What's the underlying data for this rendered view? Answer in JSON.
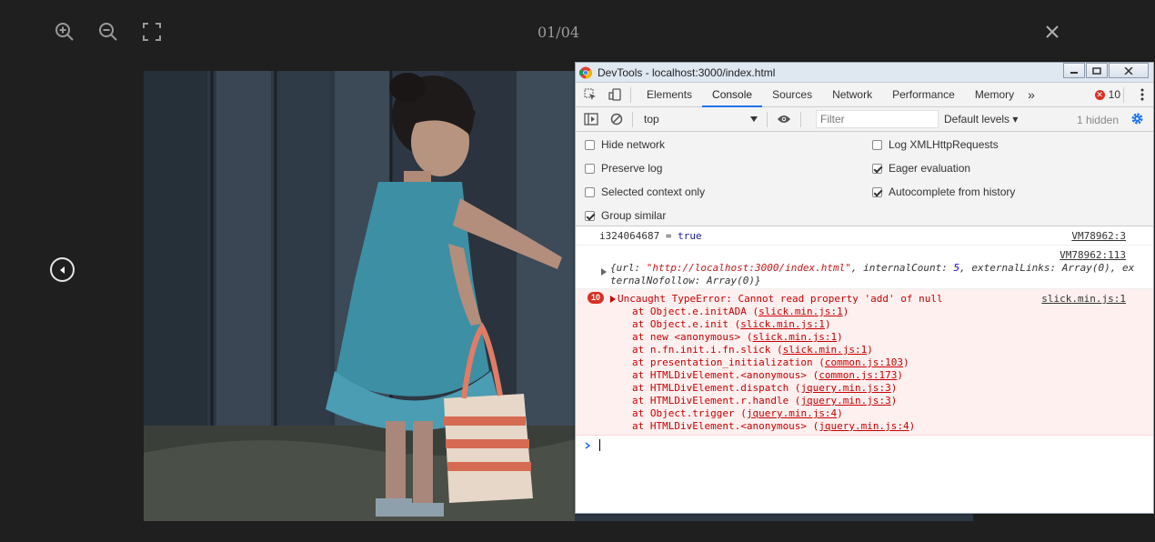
{
  "lightbox": {
    "counter": "01/04",
    "tools": [
      "zoom-in-icon",
      "zoom-out-icon",
      "fullscreen-icon"
    ]
  },
  "devtools": {
    "title": "DevTools - localhost:3000/index.html",
    "tabs": [
      "Elements",
      "Console",
      "Sources",
      "Network",
      "Performance",
      "Memory"
    ],
    "active_tab": "Console",
    "more_tabs": "»",
    "error_count": "10",
    "context": "top",
    "filter_placeholder": "Filter",
    "levels": "Default levels ▾",
    "hidden": "1 hidden",
    "settings": {
      "hide_network": "Hide network",
      "preserve_log": "Preserve log",
      "selected_context": "Selected context only",
      "group_similar": "Group similar",
      "log_xhr": "Log XMLHttpRequests",
      "eager_eval": "Eager evaluation",
      "autocomplete": "Autocomplete from history"
    },
    "messages": {
      "m1_text": "i324064687 = ",
      "m1_val": "true",
      "m1_src": "VM78962:3",
      "m2_src": "VM78962:113",
      "m2_a": "{url: ",
      "m2_url": "\"http://localhost:3000/index.html\"",
      "m2_b": ", internalCount: ",
      "m2_count": "5",
      "m2_c": ", externalLinks: Array(0), ex",
      "m2_d": "ternalNofollow: Array(0)}",
      "err_badge": "10",
      "err_text": "Uncaught TypeError: Cannot read property 'add' of null",
      "err_src": "slick.min.js:1",
      "stack": [
        {
          "pre": "at Object.e.initADA (",
          "link": "slick.min.js:1",
          "post": ")"
        },
        {
          "pre": "at Object.e.init (",
          "link": "slick.min.js:1",
          "post": ")"
        },
        {
          "pre": "at new <anonymous> (",
          "link": "slick.min.js:1",
          "post": ")"
        },
        {
          "pre": "at n.fn.init.i.fn.slick (",
          "link": "slick.min.js:1",
          "post": ")"
        },
        {
          "pre": "at presentation_initialization (",
          "link": "common.js:103",
          "post": ")"
        },
        {
          "pre": "at HTMLDivElement.<anonymous> (",
          "link": "common.js:173",
          "post": ")"
        },
        {
          "pre": "at HTMLDivElement.dispatch (",
          "link": "jquery.min.js:3",
          "post": ")"
        },
        {
          "pre": "at HTMLDivElement.r.handle (",
          "link": "jquery.min.js:3",
          "post": ")"
        },
        {
          "pre": "at Object.trigger (",
          "link": "jquery.min.js:4",
          "post": ")"
        },
        {
          "pre": "at HTMLDivElement.<anonymous> (",
          "link": "jquery.min.js:4",
          "post": ")"
        }
      ]
    }
  }
}
